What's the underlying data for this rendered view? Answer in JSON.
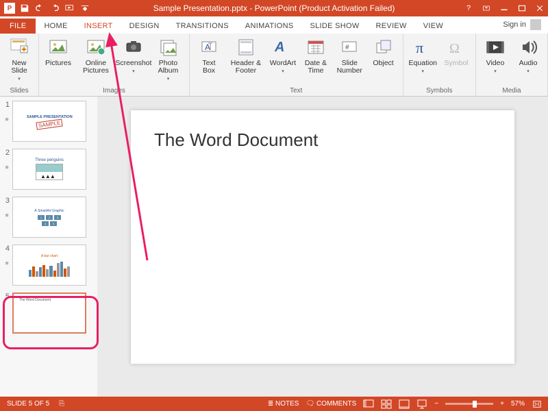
{
  "colors": {
    "brand": "#d24726",
    "highlight": "#e91e63"
  },
  "titlebar": {
    "app_abbr": "P",
    "title": "Sample Presentation.pptx -  PowerPoint (Product Activation Failed)"
  },
  "tabs": {
    "file": "FILE",
    "home": "HOME",
    "insert": "INSERT",
    "design": "DESIGN",
    "transitions": "TRANSITIONS",
    "animations": "ANIMATIONS",
    "slideshow": "SLIDE SHOW",
    "review": "REVIEW",
    "view": "VIEW",
    "signin": "Sign in"
  },
  "ribbon": {
    "groups": {
      "slides": "Slides",
      "images": "Images",
      "text": "Text",
      "symbols": "Symbols",
      "media": "Media"
    },
    "buttons": {
      "new_slide": "New\nSlide",
      "pictures": "Pictures",
      "online_pictures": "Online\nPictures",
      "screenshot": "Screenshot",
      "photo_album": "Photo\nAlbum",
      "text_box": "Text\nBox",
      "header_footer": "Header\n& Footer",
      "wordart": "WordArt",
      "date_time": "Date &\nTime",
      "slide_number": "Slide\nNumber",
      "object": "Object",
      "equation": "Equation",
      "symbol": "Symbol",
      "video": "Video",
      "audio": "Audio"
    }
  },
  "thumbnails": [
    {
      "num": "1",
      "title": "SAMPLE PRESENTATION",
      "stamp": "SAMPLE"
    },
    {
      "num": "2",
      "title": "Three penguins"
    },
    {
      "num": "3",
      "title": "A SmartArt Graphic"
    },
    {
      "num": "4",
      "title": "A bar chart"
    },
    {
      "num": "5",
      "title": "The Word Document"
    }
  ],
  "slide": {
    "heading": "The Word Document"
  },
  "status": {
    "counter": "SLIDE 5 OF 5",
    "notes": "NOTES",
    "comments": "COMMENTS",
    "zoom": "57%"
  }
}
